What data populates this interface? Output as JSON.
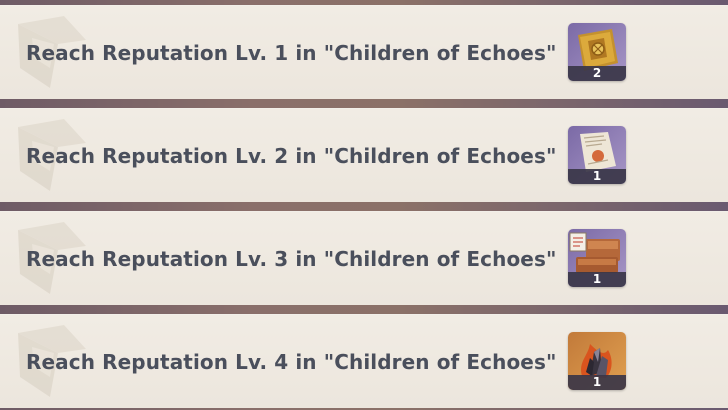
{
  "achievements": [
    {
      "title": "Reach Reputation Lv. 1 in \"Children of Echoes\"",
      "reward_icon": "golden-map-icon",
      "reward_count": "2"
    },
    {
      "title": "Reach Reputation Lv. 2 in \"Children of Echoes\"",
      "reward_icon": "recipe-scroll-icon",
      "reward_count": "1"
    },
    {
      "title": "Reach Reputation Lv. 3 in \"Children of Echoes\"",
      "reward_icon": "furnishing-blueprint-icon",
      "reward_count": "1"
    },
    {
      "title": "Reach Reputation Lv. 4 in \"Children of Echoes\"",
      "reward_icon": "crystal-flame-icon",
      "reward_count": "1"
    }
  ],
  "colors": {
    "row_background": "#eee8df",
    "title_text": "#4a4f5c",
    "reward_frame": "#8a7cae",
    "count_bar": "#3a3648"
  }
}
